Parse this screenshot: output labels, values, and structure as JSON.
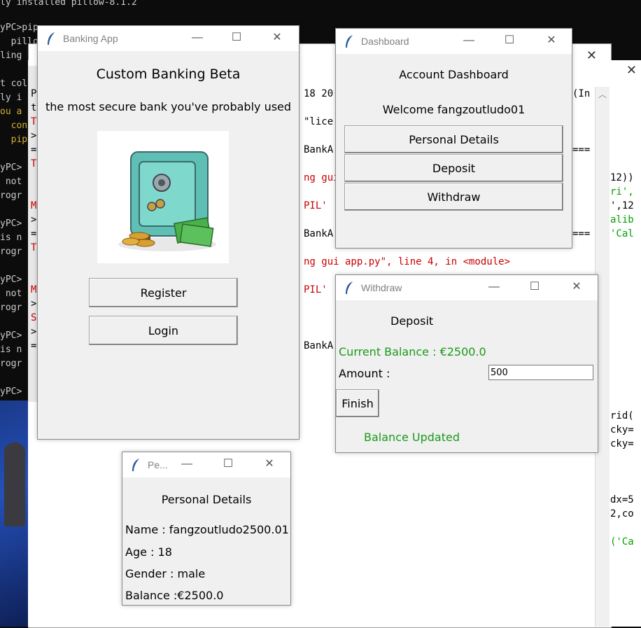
{
  "terminal": {
    "lines": [
      {
        "text": "ly installed pillow-8.1.2",
        "color": ""
      },
      {
        "text": "yPC>pip",
        "color": ""
      },
      {
        "text": "  pillo",
        "color": ""
      },
      {
        "text": "ling",
        "color": ""
      },
      {
        "text": "t col",
        "color": ""
      },
      {
        "text": "ly i",
        "color": ""
      },
      {
        "text": "ou a",
        "color": "yellow"
      },
      {
        "text": "  con",
        "color": "yellow"
      },
      {
        "text": "  pip",
        "color": "yellow"
      },
      {
        "text": "yPC>",
        "color": ""
      },
      {
        "text": " not",
        "color": ""
      },
      {
        "text": "rogr",
        "color": ""
      },
      {
        "text": "yPC>",
        "color": ""
      },
      {
        "text": "is n",
        "color": ""
      },
      {
        "text": "rogr",
        "color": ""
      },
      {
        "text": "yPC>",
        "color": ""
      },
      {
        "text": " not",
        "color": ""
      },
      {
        "text": "rogr",
        "color": ""
      },
      {
        "text": "yPC>",
        "color": ""
      },
      {
        "text": "is n",
        "color": ""
      },
      {
        "text": "rogr",
        "color": ""
      },
      {
        "text": "yPC>",
        "color": ""
      }
    ]
  },
  "editor": {
    "left_gutter": [
      "P",
      "t",
      "T",
      ">",
      "=",
      "T",
      "M",
      ">",
      "=",
      "T",
      "M",
      ">",
      "S",
      ">",
      "="
    ],
    "code_lines": [
      {
        "text": "18 20",
        "color": ""
      },
      {
        "text": "\"lice",
        "color": ""
      },
      {
        "text": "BankA",
        "color": ""
      },
      {
        "text": "ng gui",
        "color": "red"
      },
      {
        "text": "PIL'",
        "color": "red"
      },
      {
        "text": "BankA",
        "color": ""
      },
      {
        "text": "ng gui app.py\", line 4, in <module>",
        "color": "red"
      },
      {
        "text": "PIL'",
        "color": "red"
      },
      {
        "text": "BankA",
        "color": ""
      }
    ],
    "right_code": [
      {
        "text": "(In",
        "color": ""
      },
      {
        "text": "12))",
        "color": ""
      },
      {
        "text": "ri',",
        "color": "green"
      },
      {
        "text": "',12",
        "color": ""
      },
      {
        "text": "alib",
        "color": "green"
      },
      {
        "text": "'Cal",
        "color": "green"
      },
      {
        "text": "rid(",
        "color": ""
      },
      {
        "text": "cky=",
        "color": ""
      },
      {
        "text": "cky=",
        "color": ""
      },
      {
        "text": "dx=5",
        "color": ""
      },
      {
        "text": "2,co",
        "color": ""
      },
      {
        "text": "('Ca",
        "color": "green"
      }
    ],
    "separator": "===",
    "close_glyph": "✕"
  },
  "banking_app": {
    "title": "Banking App",
    "heading": "Custom Banking Beta",
    "subtitle": "the most secure bank you've probably used",
    "register_label": "Register",
    "login_label": "Login"
  },
  "dashboard": {
    "title": "Dashboard",
    "heading": "Account Dashboard",
    "welcome": "Welcome fangzoutludo01",
    "personal_details_label": "Personal Details",
    "deposit_label": "Deposit",
    "withdraw_label": "Withdraw"
  },
  "withdraw": {
    "title": "Withdraw",
    "heading": "Deposit",
    "balance": "Current Balance : €2500.0",
    "amount_label": "Amount :",
    "amount_value": "500",
    "finish_label": "Finish",
    "status": "Balance Updated"
  },
  "personal": {
    "title": "Pe...",
    "heading": "Personal Details",
    "name": "Name : fangzoutludo2500.01",
    "age": "Age : 18",
    "gender": "Gender : male",
    "balance": "Balance :€2500.0"
  },
  "window_controls": {
    "minimize": "—",
    "maximize": "☐",
    "close": "✕"
  },
  "colors": {
    "success_green": "#1a9a1a",
    "error_red": "#c80000"
  }
}
